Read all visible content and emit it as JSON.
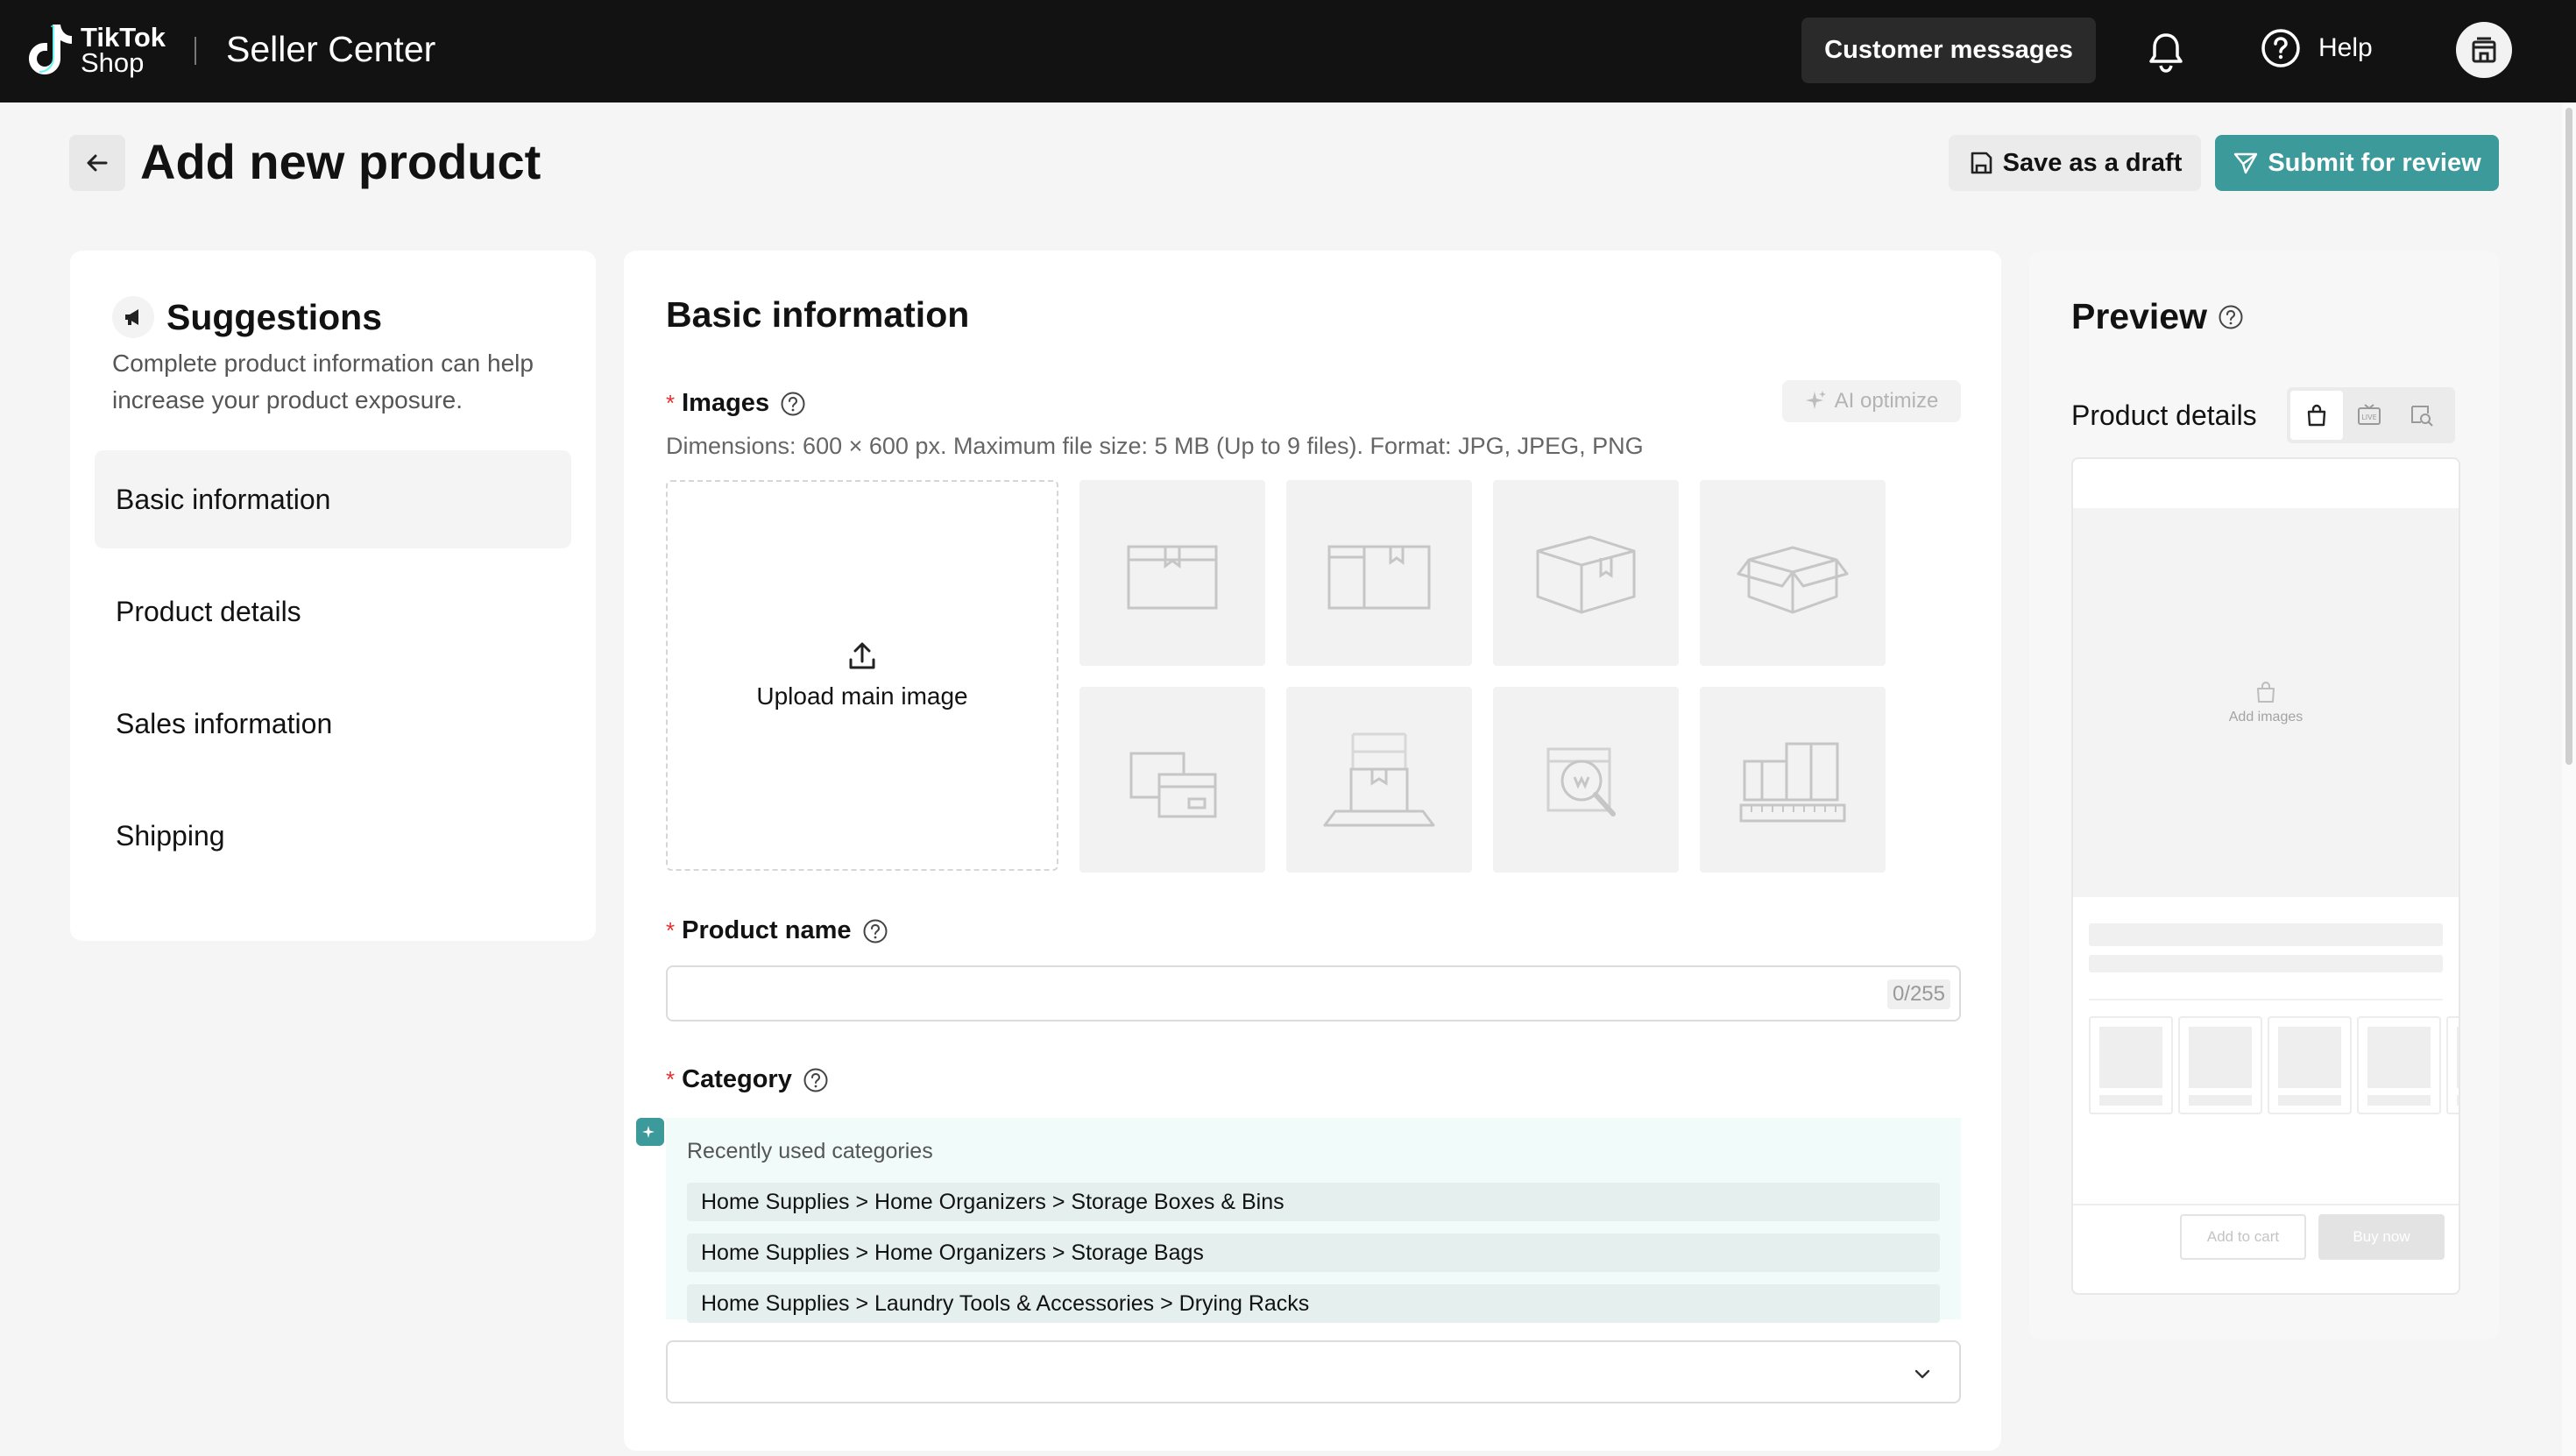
{
  "topbar": {
    "logo_line1": "TikTok",
    "logo_line2": "Shop",
    "app_name": "Seller Center",
    "customer_messages": "Customer messages",
    "help": "Help"
  },
  "header": {
    "title": "Add new product",
    "save_draft": "Save as a draft",
    "submit": "Submit for review"
  },
  "suggestions": {
    "title": "Suggestions",
    "description": "Complete product information can help increase your product exposure.",
    "items": [
      {
        "label": "Basic information",
        "active": true
      },
      {
        "label": "Product details",
        "active": false
      },
      {
        "label": "Sales information",
        "active": false
      },
      {
        "label": "Shipping",
        "active": false
      }
    ]
  },
  "basic": {
    "title": "Basic information",
    "images_label": "Images",
    "ai_optimize": "AI optimize",
    "images_hint": "Dimensions: 600 × 600 px. Maximum file size: 5 MB (Up to 9 files). Format: JPG, JPEG, PNG",
    "upload_label": "Upload main image",
    "thumbnails": [
      "box-front-icon",
      "box-side-icon",
      "box-angle-icon",
      "box-open-icon",
      "box-stack-icon",
      "box-scale-icon",
      "box-inspect-icon",
      "box-measure-icon"
    ],
    "product_name_label": "Product name",
    "product_name_value": "",
    "product_name_counter": "0/255",
    "category_label": "Category",
    "recent_categories_label": "Recently used categories",
    "recent_categories": [
      "Home Supplies > Home Organizers > Storage Boxes & Bins",
      "Home Supplies > Home Organizers > Storage Bags",
      "Home Supplies > Laundry Tools & Accessories > Drying Racks"
    ],
    "category_value": ""
  },
  "preview": {
    "title": "Preview",
    "subtitle": "Product details",
    "tabs": [
      "shop-bag-icon",
      "live-icon",
      "search-preview-icon"
    ],
    "add_images": "Add images",
    "add_to_cart": "Add to cart",
    "buy_now": "Buy now"
  },
  "colors": {
    "accent": "#3d9a9a",
    "topbar": "#121212",
    "required": "#e03131"
  }
}
